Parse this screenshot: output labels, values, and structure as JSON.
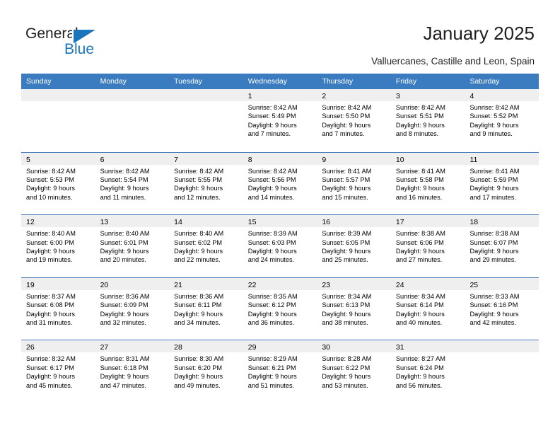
{
  "brand": {
    "name_part1": "General",
    "name_part2": "Blue",
    "triangle_icon": "triangle-icon",
    "accent_color": "#1b75bb"
  },
  "header": {
    "title": "January 2025",
    "location": "Valluercanes, Castille and Leon, Spain",
    "header_bar_color": "#3b7cc0",
    "cell_head_color": "#efefef",
    "row_divider_color": "#4a7ebb"
  },
  "weekdays": [
    "Sunday",
    "Monday",
    "Tuesday",
    "Wednesday",
    "Thursday",
    "Friday",
    "Saturday"
  ],
  "weeks": [
    [
      {
        "day": "",
        "empty": true
      },
      {
        "day": "",
        "empty": true
      },
      {
        "day": "",
        "empty": true
      },
      {
        "day": "1",
        "sunrise": "Sunrise: 8:42 AM",
        "sunset": "Sunset: 5:49 PM",
        "daylight1": "Daylight: 9 hours",
        "daylight2": "and 7 minutes."
      },
      {
        "day": "2",
        "sunrise": "Sunrise: 8:42 AM",
        "sunset": "Sunset: 5:50 PM",
        "daylight1": "Daylight: 9 hours",
        "daylight2": "and 7 minutes."
      },
      {
        "day": "3",
        "sunrise": "Sunrise: 8:42 AM",
        "sunset": "Sunset: 5:51 PM",
        "daylight1": "Daylight: 9 hours",
        "daylight2": "and 8 minutes."
      },
      {
        "day": "4",
        "sunrise": "Sunrise: 8:42 AM",
        "sunset": "Sunset: 5:52 PM",
        "daylight1": "Daylight: 9 hours",
        "daylight2": "and 9 minutes."
      }
    ],
    [
      {
        "day": "5",
        "sunrise": "Sunrise: 8:42 AM",
        "sunset": "Sunset: 5:53 PM",
        "daylight1": "Daylight: 9 hours",
        "daylight2": "and 10 minutes."
      },
      {
        "day": "6",
        "sunrise": "Sunrise: 8:42 AM",
        "sunset": "Sunset: 5:54 PM",
        "daylight1": "Daylight: 9 hours",
        "daylight2": "and 11 minutes."
      },
      {
        "day": "7",
        "sunrise": "Sunrise: 8:42 AM",
        "sunset": "Sunset: 5:55 PM",
        "daylight1": "Daylight: 9 hours",
        "daylight2": "and 12 minutes."
      },
      {
        "day": "8",
        "sunrise": "Sunrise: 8:42 AM",
        "sunset": "Sunset: 5:56 PM",
        "daylight1": "Daylight: 9 hours",
        "daylight2": "and 14 minutes."
      },
      {
        "day": "9",
        "sunrise": "Sunrise: 8:41 AM",
        "sunset": "Sunset: 5:57 PM",
        "daylight1": "Daylight: 9 hours",
        "daylight2": "and 15 minutes."
      },
      {
        "day": "10",
        "sunrise": "Sunrise: 8:41 AM",
        "sunset": "Sunset: 5:58 PM",
        "daylight1": "Daylight: 9 hours",
        "daylight2": "and 16 minutes."
      },
      {
        "day": "11",
        "sunrise": "Sunrise: 8:41 AM",
        "sunset": "Sunset: 5:59 PM",
        "daylight1": "Daylight: 9 hours",
        "daylight2": "and 17 minutes."
      }
    ],
    [
      {
        "day": "12",
        "sunrise": "Sunrise: 8:40 AM",
        "sunset": "Sunset: 6:00 PM",
        "daylight1": "Daylight: 9 hours",
        "daylight2": "and 19 minutes."
      },
      {
        "day": "13",
        "sunrise": "Sunrise: 8:40 AM",
        "sunset": "Sunset: 6:01 PM",
        "daylight1": "Daylight: 9 hours",
        "daylight2": "and 20 minutes."
      },
      {
        "day": "14",
        "sunrise": "Sunrise: 8:40 AM",
        "sunset": "Sunset: 6:02 PM",
        "daylight1": "Daylight: 9 hours",
        "daylight2": "and 22 minutes."
      },
      {
        "day": "15",
        "sunrise": "Sunrise: 8:39 AM",
        "sunset": "Sunset: 6:03 PM",
        "daylight1": "Daylight: 9 hours",
        "daylight2": "and 24 minutes."
      },
      {
        "day": "16",
        "sunrise": "Sunrise: 8:39 AM",
        "sunset": "Sunset: 6:05 PM",
        "daylight1": "Daylight: 9 hours",
        "daylight2": "and 25 minutes."
      },
      {
        "day": "17",
        "sunrise": "Sunrise: 8:38 AM",
        "sunset": "Sunset: 6:06 PM",
        "daylight1": "Daylight: 9 hours",
        "daylight2": "and 27 minutes."
      },
      {
        "day": "18",
        "sunrise": "Sunrise: 8:38 AM",
        "sunset": "Sunset: 6:07 PM",
        "daylight1": "Daylight: 9 hours",
        "daylight2": "and 29 minutes."
      }
    ],
    [
      {
        "day": "19",
        "sunrise": "Sunrise: 8:37 AM",
        "sunset": "Sunset: 6:08 PM",
        "daylight1": "Daylight: 9 hours",
        "daylight2": "and 31 minutes."
      },
      {
        "day": "20",
        "sunrise": "Sunrise: 8:36 AM",
        "sunset": "Sunset: 6:09 PM",
        "daylight1": "Daylight: 9 hours",
        "daylight2": "and 32 minutes."
      },
      {
        "day": "21",
        "sunrise": "Sunrise: 8:36 AM",
        "sunset": "Sunset: 6:11 PM",
        "daylight1": "Daylight: 9 hours",
        "daylight2": "and 34 minutes."
      },
      {
        "day": "22",
        "sunrise": "Sunrise: 8:35 AM",
        "sunset": "Sunset: 6:12 PM",
        "daylight1": "Daylight: 9 hours",
        "daylight2": "and 36 minutes."
      },
      {
        "day": "23",
        "sunrise": "Sunrise: 8:34 AM",
        "sunset": "Sunset: 6:13 PM",
        "daylight1": "Daylight: 9 hours",
        "daylight2": "and 38 minutes."
      },
      {
        "day": "24",
        "sunrise": "Sunrise: 8:34 AM",
        "sunset": "Sunset: 6:14 PM",
        "daylight1": "Daylight: 9 hours",
        "daylight2": "and 40 minutes."
      },
      {
        "day": "25",
        "sunrise": "Sunrise: 8:33 AM",
        "sunset": "Sunset: 6:16 PM",
        "daylight1": "Daylight: 9 hours",
        "daylight2": "and 42 minutes."
      }
    ],
    [
      {
        "day": "26",
        "sunrise": "Sunrise: 8:32 AM",
        "sunset": "Sunset: 6:17 PM",
        "daylight1": "Daylight: 9 hours",
        "daylight2": "and 45 minutes."
      },
      {
        "day": "27",
        "sunrise": "Sunrise: 8:31 AM",
        "sunset": "Sunset: 6:18 PM",
        "daylight1": "Daylight: 9 hours",
        "daylight2": "and 47 minutes."
      },
      {
        "day": "28",
        "sunrise": "Sunrise: 8:30 AM",
        "sunset": "Sunset: 6:20 PM",
        "daylight1": "Daylight: 9 hours",
        "daylight2": "and 49 minutes."
      },
      {
        "day": "29",
        "sunrise": "Sunrise: 8:29 AM",
        "sunset": "Sunset: 6:21 PM",
        "daylight1": "Daylight: 9 hours",
        "daylight2": "and 51 minutes."
      },
      {
        "day": "30",
        "sunrise": "Sunrise: 8:28 AM",
        "sunset": "Sunset: 6:22 PM",
        "daylight1": "Daylight: 9 hours",
        "daylight2": "and 53 minutes."
      },
      {
        "day": "31",
        "sunrise": "Sunrise: 8:27 AM",
        "sunset": "Sunset: 6:24 PM",
        "daylight1": "Daylight: 9 hours",
        "daylight2": "and 56 minutes."
      },
      {
        "day": "",
        "empty": true
      }
    ]
  ]
}
